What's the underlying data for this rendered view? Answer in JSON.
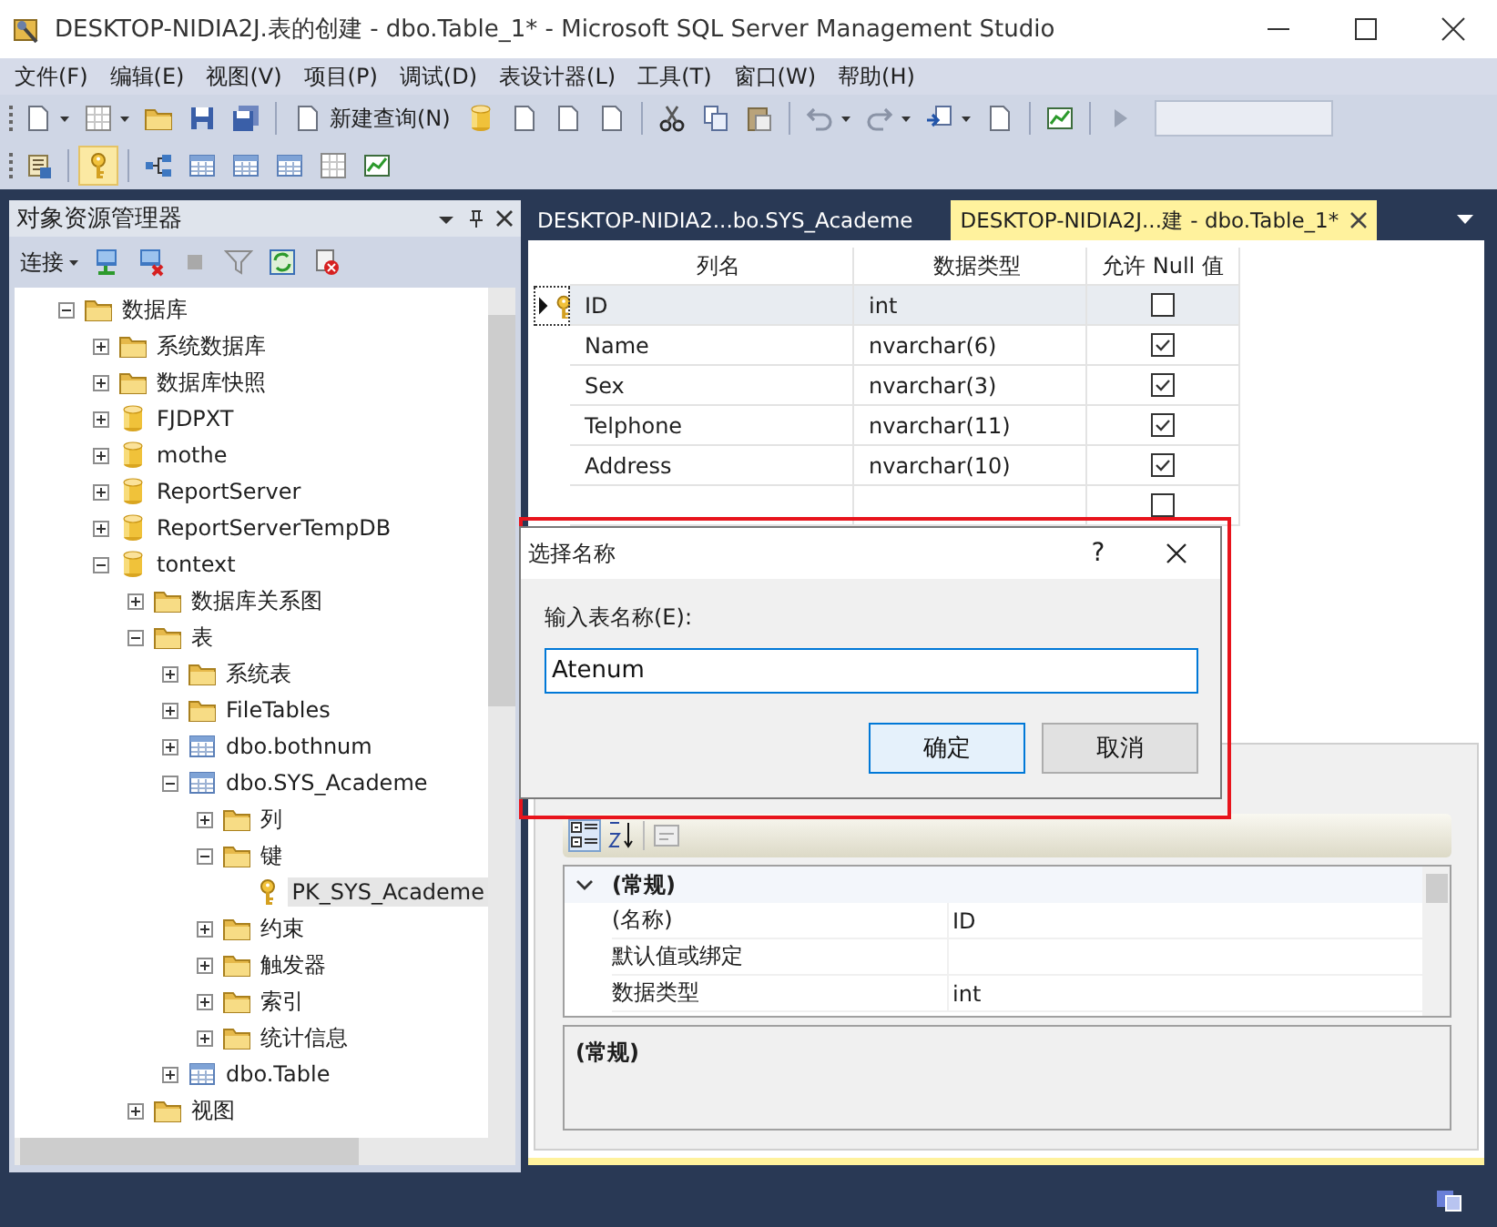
{
  "window": {
    "title": "DESKTOP-NIDIA2J.表的创建 - dbo.Table_1* - Microsoft SQL Server Management Studio"
  },
  "menu": [
    "文件(F)",
    "编辑(E)",
    "视图(V)",
    "项目(P)",
    "调试(D)",
    "表设计器(L)",
    "工具(T)",
    "窗口(W)",
    "帮助(H)"
  ],
  "toolbar": {
    "new_query": "新建查询(N)",
    "primary_key_pressed": true
  },
  "object_explorer": {
    "title": "对象资源管理器",
    "connect": "连接",
    "tree": [
      {
        "label": "数据库",
        "kind": "folder",
        "expanded": true,
        "selected": false,
        "children": [
          {
            "label": "系统数据库",
            "kind": "folder",
            "expanded": false,
            "selected": false
          },
          {
            "label": "数据库快照",
            "kind": "folder",
            "expanded": false,
            "selected": false
          },
          {
            "label": "FJDPXT",
            "kind": "database",
            "expanded": false,
            "selected": false
          },
          {
            "label": "mothe",
            "kind": "database",
            "expanded": false,
            "selected": false
          },
          {
            "label": "ReportServer",
            "kind": "database",
            "expanded": false,
            "selected": false
          },
          {
            "label": "ReportServerTempDB",
            "kind": "database",
            "expanded": false,
            "selected": false
          },
          {
            "label": "tontext",
            "kind": "database",
            "expanded": true,
            "selected": false,
            "children": [
              {
                "label": "数据库关系图",
                "kind": "folder",
                "expanded": false,
                "selected": false
              },
              {
                "label": "表",
                "kind": "folder",
                "expanded": true,
                "selected": false,
                "children": [
                  {
                    "label": "系统表",
                    "kind": "folder",
                    "expanded": false,
                    "selected": false
                  },
                  {
                    "label": "FileTables",
                    "kind": "folder",
                    "expanded": false,
                    "selected": false
                  },
                  {
                    "label": "dbo.bothnum",
                    "kind": "table",
                    "expanded": false,
                    "selected": false
                  },
                  {
                    "label": "dbo.SYS_Academe",
                    "kind": "table",
                    "expanded": true,
                    "selected": false,
                    "children": [
                      {
                        "label": "列",
                        "kind": "folder",
                        "expanded": false,
                        "selected": false
                      },
                      {
                        "label": "键",
                        "kind": "folder",
                        "expanded": true,
                        "selected": false,
                        "children": [
                          {
                            "label": "PK_SYS_Academe",
                            "kind": "key",
                            "selected": true
                          }
                        ]
                      },
                      {
                        "label": "约束",
                        "kind": "folder",
                        "expanded": false,
                        "selected": false
                      },
                      {
                        "label": "触发器",
                        "kind": "folder",
                        "expanded": false,
                        "selected": false
                      },
                      {
                        "label": "索引",
                        "kind": "folder",
                        "expanded": false,
                        "selected": false
                      },
                      {
                        "label": "统计信息",
                        "kind": "folder",
                        "expanded": false,
                        "selected": false
                      }
                    ]
                  },
                  {
                    "label": "dbo.Table",
                    "kind": "table",
                    "expanded": false,
                    "selected": false
                  }
                ]
              },
              {
                "label": "视图",
                "kind": "folder",
                "expanded": false,
                "selected": false
              }
            ]
          }
        ]
      }
    ]
  },
  "tabs": [
    {
      "label": "DESKTOP-NIDIA2...bo.SYS_Academe",
      "selected": false
    },
    {
      "label": "DESKTOP-NIDIA2J...建 - dbo.Table_1*",
      "selected": true
    }
  ],
  "table": {
    "columns": [
      "列名",
      "数据类型",
      "允许 Null 值"
    ],
    "rows": [
      {
        "name": "ID",
        "type": "int",
        "allow_null": false,
        "primary_key": true,
        "current": true
      },
      {
        "name": "Name",
        "type": "nvarchar(6)",
        "allow_null": true,
        "primary_key": false,
        "current": false
      },
      {
        "name": "Sex",
        "type": "nvarchar(3)",
        "allow_null": true,
        "primary_key": false,
        "current": false
      },
      {
        "name": "Telphone",
        "type": "nvarchar(11)",
        "allow_null": true,
        "primary_key": false,
        "current": false
      },
      {
        "name": "Address",
        "type": "nvarchar(10)",
        "allow_null": true,
        "primary_key": false,
        "current": false
      },
      {
        "allow_null": false,
        "primary_key": false,
        "current": false
      }
    ]
  },
  "properties": {
    "category": "(常规)",
    "rows": [
      {
        "name": "(名称)",
        "value": "ID"
      },
      {
        "name": "默认值或绑定"
      },
      {
        "name": "数据类型",
        "value": "int"
      }
    ],
    "description": "(常规)"
  },
  "dialog": {
    "title": "选择名称",
    "help": "?",
    "label": "输入表名称(E):",
    "value": "Atenum",
    "buttons": [
      {
        "label": "确定",
        "default": true
      },
      {
        "label": "取消",
        "default": false
      }
    ]
  }
}
